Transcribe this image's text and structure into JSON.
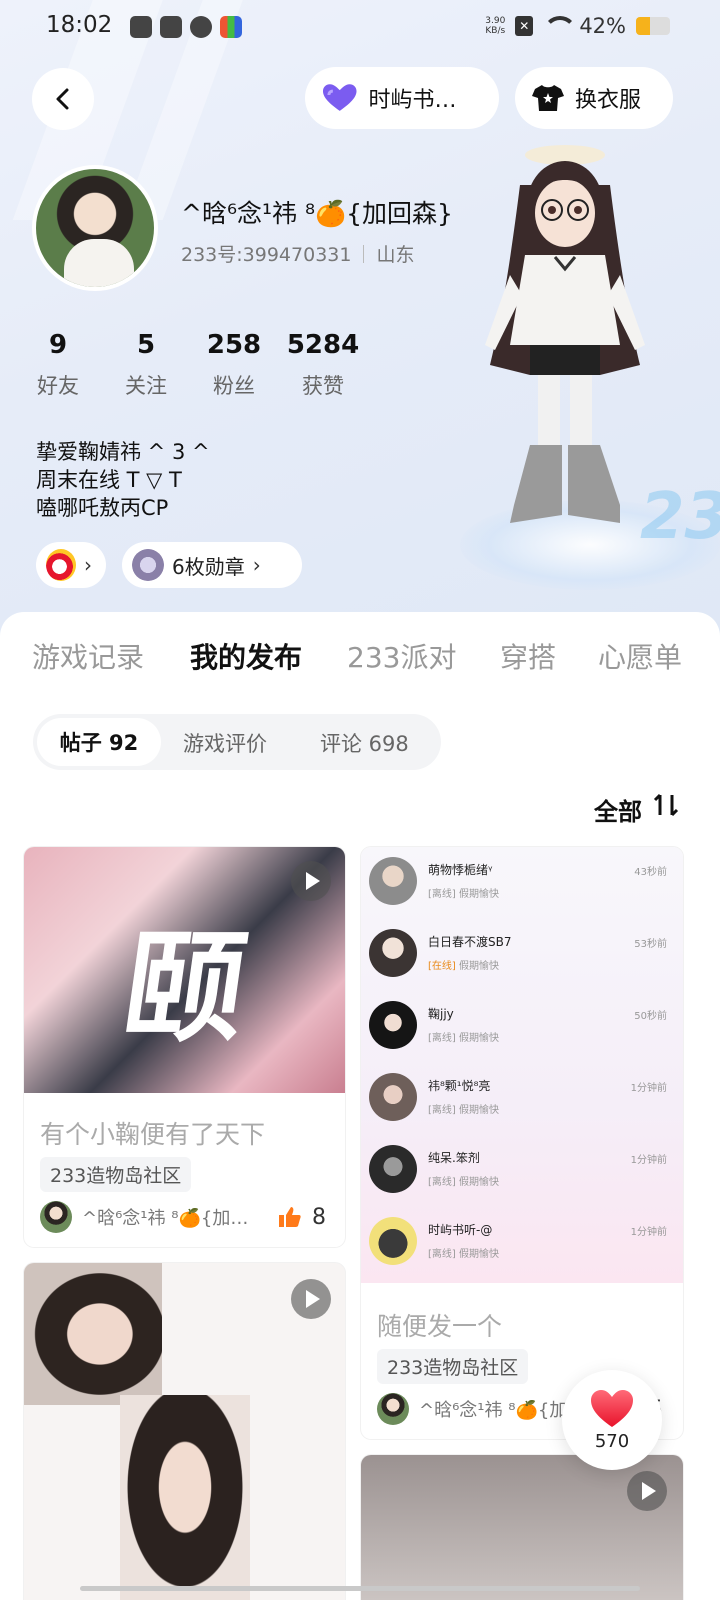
{
  "status_bar": {
    "time": "18:02",
    "net_speed_value": "3.90",
    "net_speed_unit": "KB/s",
    "battery": "42%",
    "battery_level": 0.42,
    "battery_color": "#f6b21b"
  },
  "header": {
    "voice_label": "时屿书听…",
    "dress_label": "换衣服"
  },
  "profile": {
    "nickname": "^晗⁶念¹祎 ⁸🍊{加回森}",
    "uid": "233号:399470331",
    "location": "山东",
    "stats": [
      {
        "value": "9",
        "label": "好友"
      },
      {
        "value": "5",
        "label": "关注"
      },
      {
        "value": "258",
        "label": "粉丝"
      },
      {
        "value": "5284",
        "label": "获赞"
      }
    ],
    "bio": [
      "挚爱鞠婧祎 ^ 3 ^",
      "周末在线 T ▽ T",
      "嗑哪吒敖丙CP"
    ],
    "medal_label": "6枚勋章"
  },
  "deco_text": "233",
  "tabs": [
    "游戏记录",
    "我的发布",
    "233派对",
    "穿搭",
    "心愿单"
  ],
  "active_tab": "我的发布",
  "accent_color": "#ff7a1a",
  "subtabs": [
    "帖子 92",
    "游戏评价",
    "评论 698"
  ],
  "sort_label": "全部",
  "posts": [
    {
      "cover_text": "颐",
      "title": "有个小鞠便有了天下",
      "tag": "233造物岛社区",
      "author": "^晗⁶念¹祎 ⁸🍊{加…",
      "likes": "8"
    },
    {
      "title": "随便发一个",
      "tag": "233造物岛社区",
      "author": "^晗⁶念¹祎 ⁸🍊{加",
      "likes": "5",
      "chat_list": [
        {
          "name": "萌物悸栀绪ᵞ",
          "status_tag": "[离线]",
          "status_text": "假期愉快",
          "time": "43秒前",
          "online": false
        },
        {
          "name": "白日春不渡SB7",
          "status_tag": "[在线]",
          "status_text": "假期愉快",
          "time": "53秒前",
          "online": true
        },
        {
          "name": "鞠jjy",
          "status_tag": "[离线]",
          "status_text": "假期愉快",
          "time": "50秒前",
          "online": false
        },
        {
          "name": "祎⁸颗¹悦⁸亮",
          "status_tag": "[离线]",
          "status_text": "假期愉快",
          "time": "1分钟前",
          "online": false
        },
        {
          "name": "纯呆.笨剂",
          "status_tag": "[离线]",
          "status_text": "假期愉快",
          "time": "1分钟前",
          "online": false
        },
        {
          "name": "时屿书听-@",
          "status_tag": "[离线]",
          "status_text": "假期愉快",
          "time": "1分钟前",
          "online": false
        }
      ]
    }
  ],
  "fav_count": "570"
}
